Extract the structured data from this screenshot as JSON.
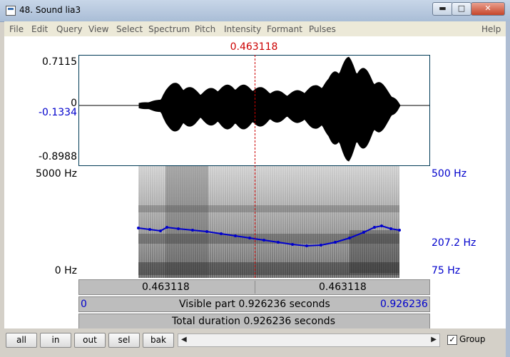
{
  "window": {
    "title": "48. Sound lia3",
    "minimize": "▬",
    "maximize": "□",
    "close": "✕"
  },
  "menu": [
    "File",
    "Edit",
    "Query",
    "View",
    "Select",
    "Spectrum",
    "Pitch",
    "Intensity",
    "Formant",
    "Pulses",
    "Help"
  ],
  "cursor": {
    "time_label": "0.463118"
  },
  "waveform": {
    "max_label": "0.7115",
    "zero_label": "0",
    "cursor_value_label": "-0.1334",
    "min_label": "-0.8988"
  },
  "spectrogram": {
    "top_freq_label": "5000 Hz",
    "bottom_freq_label": "0 Hz"
  },
  "pitch": {
    "top_label": "500 Hz",
    "cursor_label": "207.2 Hz",
    "bottom_label": "75 Hz"
  },
  "time_bar": {
    "left_label": "0.463118",
    "right_label": "0.463118"
  },
  "visible_bar": {
    "start_label": "0",
    "text": "Visible part 0.926236 seconds",
    "end_label": "0.926236"
  },
  "total_bar": {
    "text": "Total duration 0.926236 seconds"
  },
  "buttons": {
    "all": "all",
    "in": "in",
    "out": "out",
    "sel": "sel",
    "bak": "bak"
  },
  "group": {
    "label": "Group",
    "checked_mark": "✓"
  },
  "colors": {
    "cursor": "#cc0000",
    "pitch": "#0000cc",
    "frame": "#003a56"
  }
}
